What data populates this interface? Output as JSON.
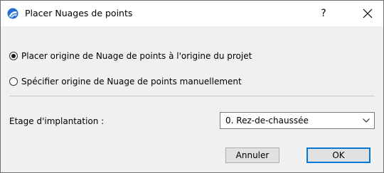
{
  "dialog": {
    "title": "Placer Nuages de points",
    "help_label": "?",
    "close_icon": "close-icon",
    "app_icon": "archicad-icon"
  },
  "origin_options": [
    {
      "label": "Placer origine de Nuage de points à l'origine du projet",
      "checked": true
    },
    {
      "label": "Spécifier origine de Nuage de points manuellement",
      "checked": false
    }
  ],
  "level": {
    "label": "Etage d'implantation :",
    "selected": "0. Rez-de-chaussée"
  },
  "buttons": {
    "cancel": "Annuler",
    "ok": "OK"
  },
  "colors": {
    "content_background": "#f0f0f0",
    "default_button_border": "#0078d7",
    "app_icon_blue": "#1f6fd0"
  }
}
